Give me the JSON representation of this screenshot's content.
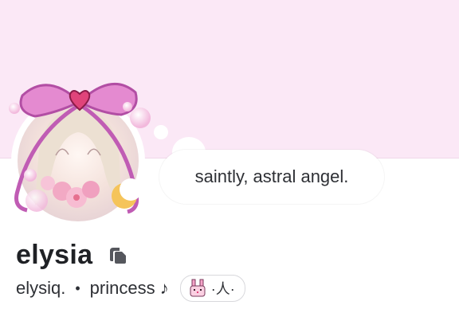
{
  "profile": {
    "status_message": "saintly, astral angel.",
    "display_name": "elysia",
    "username": "elysiq.",
    "separator": "•",
    "pronouns": "princess ♪",
    "clan_tag": "·人·",
    "icons": {
      "name_badge": "copy-icon",
      "clan_emblem": "bunny-icon",
      "moon": "crescent-moon-icon"
    }
  },
  "colors": {
    "banner": "#fbe8f6",
    "ribbon": "#d070c0",
    "moon": "#f5c45a"
  }
}
